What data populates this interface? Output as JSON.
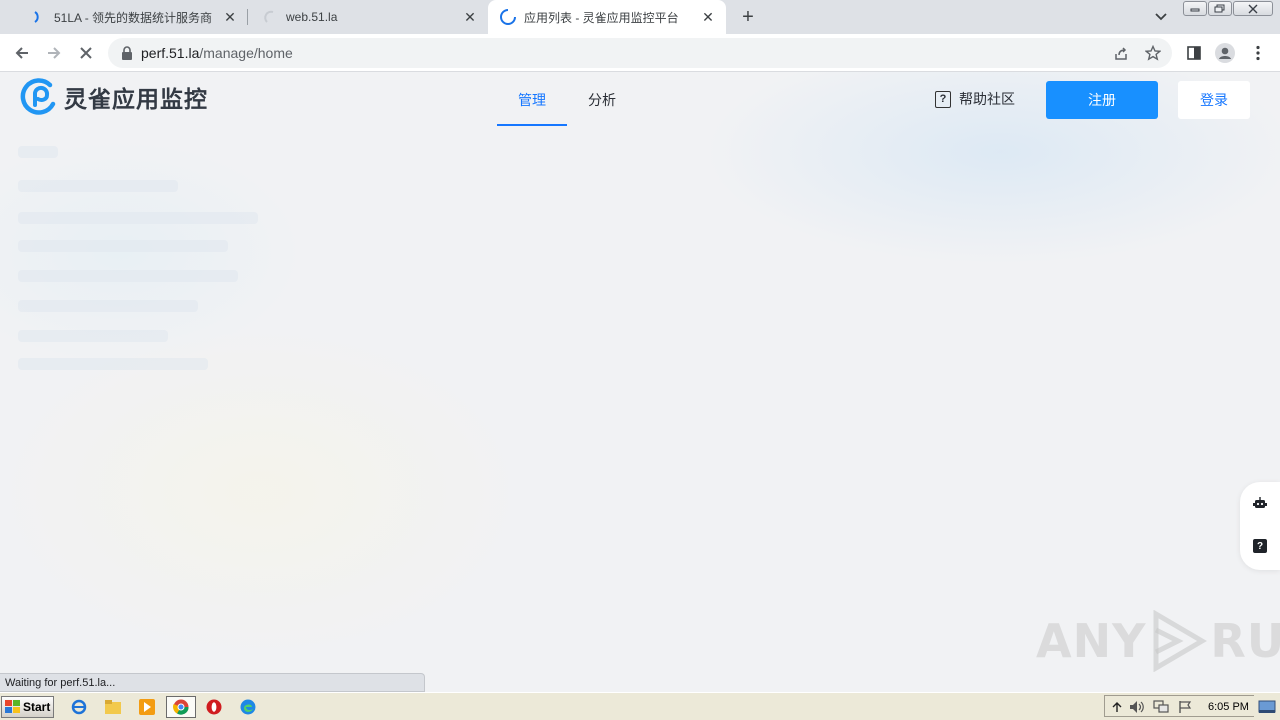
{
  "browser": {
    "tabs": [
      {
        "title": "51LA - 领先的数据统计服务商",
        "active": false
      },
      {
        "title": "web.51.la",
        "active": false
      },
      {
        "title": "应用列表 - 灵雀应用监控平台",
        "active": true
      }
    ],
    "url_host": "perf.51.la",
    "url_path": "/manage/home",
    "status_text": "Waiting for perf.51.la..."
  },
  "site": {
    "logo_text": "灵雀应用监控",
    "nav": [
      {
        "label": "管理",
        "active": true
      },
      {
        "label": "分析",
        "active": false
      }
    ],
    "help_label": "帮助社区",
    "help_icon": "?",
    "register_label": "注册",
    "login_label": "登录",
    "float_help_icon": "?"
  },
  "watermark": {
    "text_left": "ANY",
    "text_right": "RUN"
  },
  "taskbar": {
    "start_label": "Start",
    "clock": "6:05 PM"
  },
  "colors": {
    "accent": "#1890ff",
    "nav_active": "#1677ff",
    "tabstrip": "#dee1e6",
    "taskbar": "#ece9d8"
  }
}
